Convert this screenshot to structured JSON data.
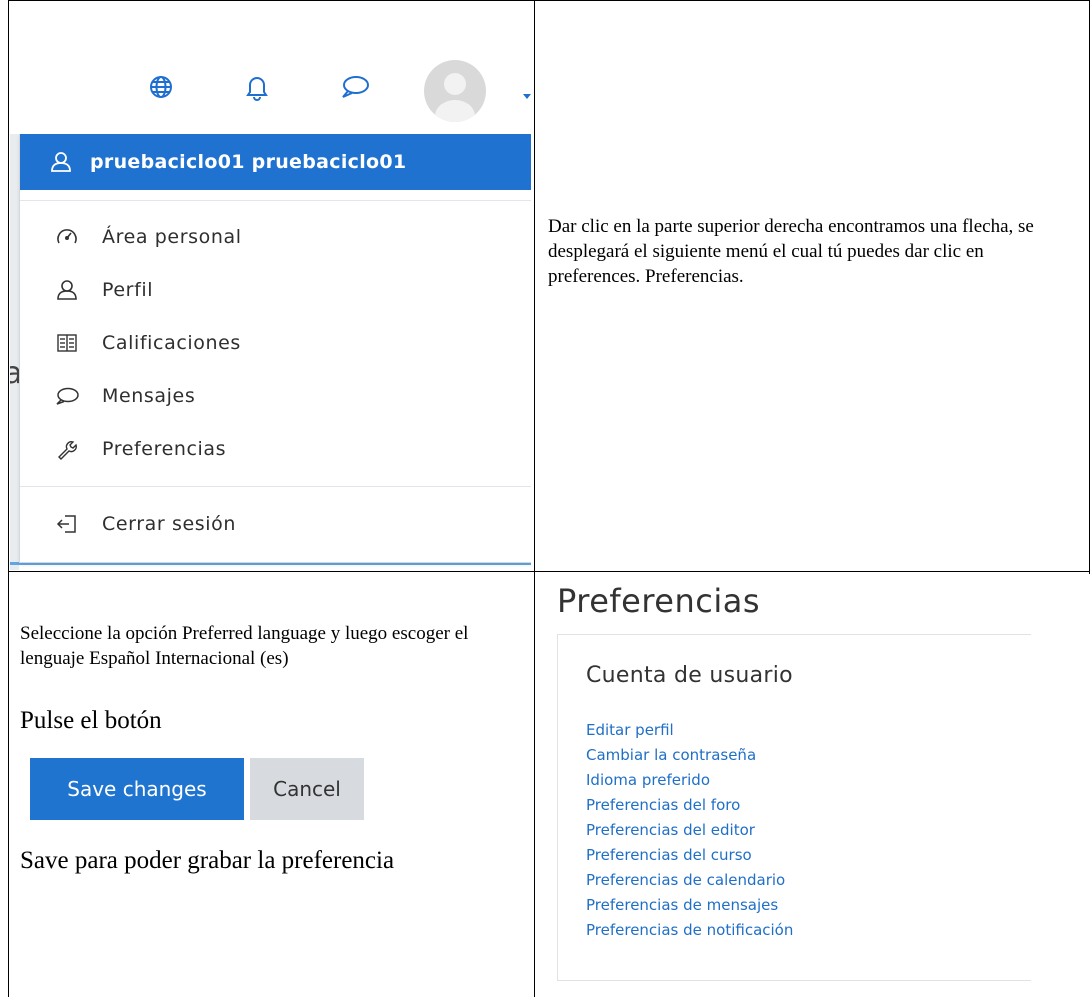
{
  "menu": {
    "user_name": "pruebaciclo01 pruebaciclo01",
    "items": [
      {
        "label": "Área personal",
        "icon": "dashboard-icon"
      },
      {
        "label": "Perfil",
        "icon": "user-icon"
      },
      {
        "label": "Calificaciones",
        "icon": "grades-book-icon"
      },
      {
        "label": "Mensajes",
        "icon": "message-bubble-icon"
      },
      {
        "label": "Preferencias",
        "icon": "wrench-icon"
      }
    ],
    "logout_label": "Cerrar sesión",
    "topbar_icons": [
      "globe-icon",
      "bell-icon",
      "chat-icon",
      "avatar",
      "caret-down-icon"
    ]
  },
  "instructions": {
    "step1": "Dar clic en la parte superior derecha encontramos una flecha, se desplegará el siguiente menú el cual tú puedes dar clic en preferences. Preferencias.",
    "step2": "Seleccione la opción Preferred language y luego escoger el lenguaje Español Internacional (es)",
    "press_button": "Pulse el botón",
    "save_note": "Save para poder grabar la preferencia"
  },
  "buttons": {
    "save_label": "Save changes",
    "cancel_label": "Cancel"
  },
  "preferences": {
    "title": "Preferencias",
    "section_title": "Cuenta de usuario",
    "links": [
      "Editar perfil",
      "Cambiar la contraseña",
      "Idioma preferido",
      "Preferencias del foro",
      "Preferencias del editor",
      "Preferencias del curso",
      "Preferencias de calendario",
      "Preferencias de mensajes",
      "Preferencias de notificación"
    ]
  },
  "colors": {
    "accent": "#1f72cf",
    "link": "#1f6fc7",
    "cancel_bg": "#d7dbdf"
  }
}
